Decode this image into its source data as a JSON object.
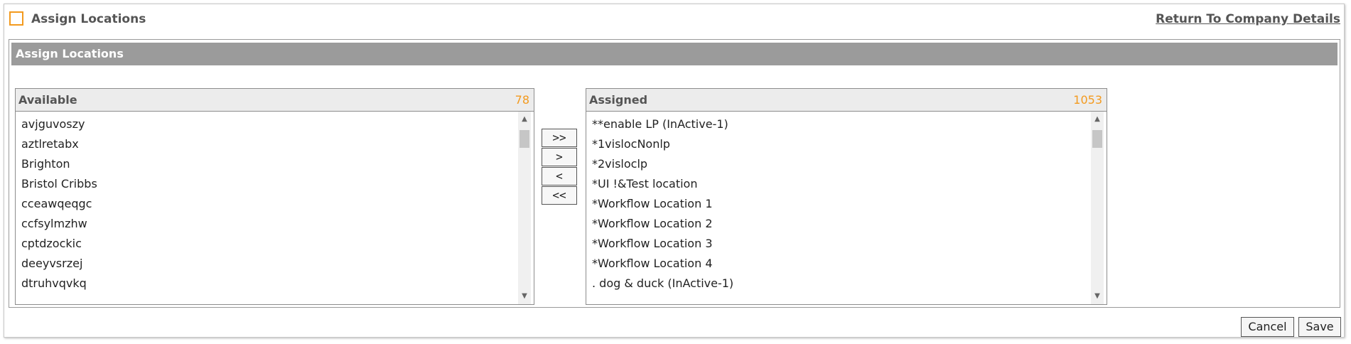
{
  "header": {
    "title": "Assign Locations",
    "return_link": "Return To Company Details"
  },
  "panel": {
    "title": "Assign Locations"
  },
  "available": {
    "label": "Available",
    "count": "78",
    "items": [
      "avjguvoszy",
      "aztlretabx",
      "Brighton",
      "Bristol Cribbs",
      "cceawqeqgc",
      "ccfsylmzhw",
      "cptdzockic",
      "deeyvsrzej",
      "dtruhvqvkq"
    ]
  },
  "assigned": {
    "label": "Assigned",
    "count": "1053",
    "items": [
      "**enable LP (InActive-1)",
      "*1vislocNonlp",
      "*2visloclp",
      "*UI !&Test location",
      "*Workflow Location 1",
      "*Workflow Location 2",
      "*Workflow Location 3",
      "*Workflow Location 4",
      ". dog & duck (InActive-1)"
    ]
  },
  "move_buttons": {
    "add_all": ">>",
    "add": ">",
    "remove": "<",
    "remove_all": "<<"
  },
  "footer": {
    "cancel": "Cancel",
    "save": "Save"
  },
  "colors": {
    "accent": "#f39a1e",
    "panel_header": "#9b9b9b"
  }
}
